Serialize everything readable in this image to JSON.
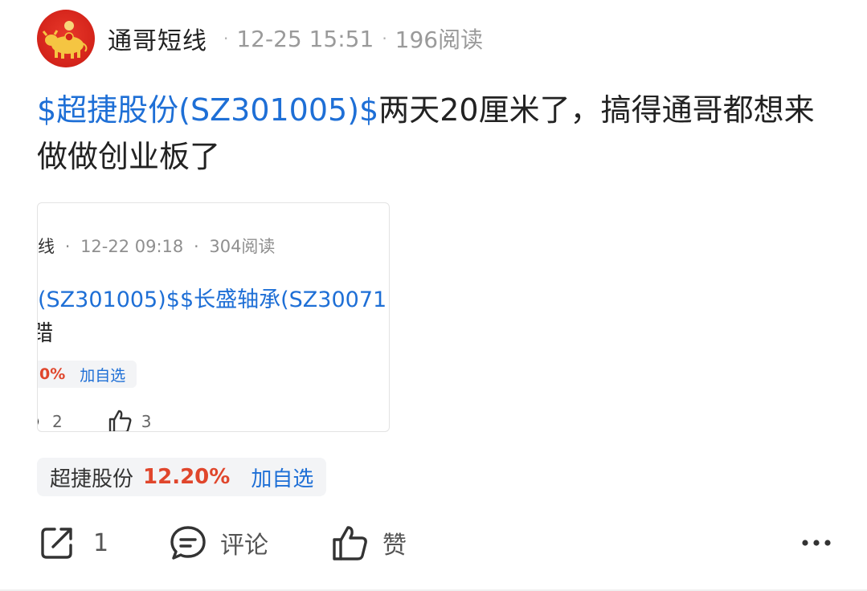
{
  "header": {
    "author": "通哥短线",
    "separator": "·",
    "timestamp": "12-25 15:51",
    "reads": "196阅读"
  },
  "post": {
    "stock_link": "$超捷股份(SZ301005)$",
    "text": "两天20厘米了，搞得通哥都想来做做创业板了"
  },
  "quoted_post": {
    "meta_tail": "线",
    "separator": "·",
    "timestamp": "12-22 09:18",
    "reads": "304阅读",
    "links_visible": "(SZ301005)$$长盛轴承(SZ30071",
    "line2_visible": "踖",
    "chip_pct_visible": "0%",
    "chip_add": "加自选",
    "comment_count": "2",
    "like_count": "3"
  },
  "stock_chip": {
    "name": "超捷股份",
    "change": "12.20%",
    "add_label": "加自选"
  },
  "actions": {
    "share_count": "1",
    "comment_label": "评论",
    "like_label": "赞"
  },
  "colors": {
    "link": "#1e6fd6",
    "rise": "#e0462c",
    "muted": "#9a9a9a",
    "avatar_bg": "#d3231a"
  },
  "icons": {
    "share": "share-icon",
    "comment": "comment-icon",
    "like": "thumbs-up-icon",
    "more": "more-dots-icon"
  }
}
